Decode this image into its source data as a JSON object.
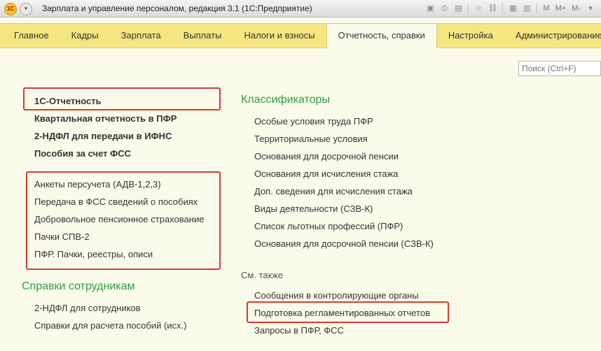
{
  "window": {
    "title": "Зарплата и управление персоналом, редакция 3.1  (1С:Предприятие)",
    "logo_text": "1С",
    "toolbar_labels": [
      "M",
      "M+",
      "M-"
    ]
  },
  "nav": {
    "tabs": [
      {
        "label": "Главное",
        "active": false
      },
      {
        "label": "Кадры",
        "active": false
      },
      {
        "label": "Зарплата",
        "active": false
      },
      {
        "label": "Выплаты",
        "active": false
      },
      {
        "label": "Налоги и взносы",
        "active": false
      },
      {
        "label": "Отчетность, справки",
        "active": true
      },
      {
        "label": "Настройка",
        "active": false
      },
      {
        "label": "Администрирование",
        "active": false
      }
    ]
  },
  "search": {
    "placeholder": "Поиск (Ctrl+F)"
  },
  "left": {
    "bold_links": [
      "1С-Отчетность",
      "Квартальная отчетность в ПФР",
      "2-НДФЛ для передачи в ИФНС",
      "Пособия за счет ФСС"
    ],
    "links": [
      "Анкеты персучета (АДВ-1,2,3)",
      "Передача в ФСС сведений о пособиях",
      "Добровольное пенсионное страхование",
      "Пачки СПВ-2",
      "ПФР. Пачки, реестры, описи"
    ],
    "spravki_heading": "Справки сотрудникам",
    "spravki_links": [
      "2-НДФЛ для сотрудников",
      "Справки для расчета пособий (исх.)"
    ]
  },
  "right": {
    "classifiers_heading": "Классификаторы",
    "classifiers": [
      "Особые условия труда ПФР",
      "Территориальные условия",
      "Основания для досрочной пенсии",
      "Основания для исчисления стажа",
      "Доп. сведения для исчисления стажа",
      "Виды деятельности (СЗВ-К)",
      "Список льготных профессий (ПФР)",
      "Основания для досрочной пенсии (СЗВ-К)"
    ],
    "see_also_label": "См. также",
    "see_also": [
      "Сообщения в контролирующие органы",
      "Подготовка регламентированных отчетов",
      "Запросы в ПФР, ФСС"
    ]
  },
  "colors": {
    "nav_bg": "#f5e681",
    "page_bg": "#fbfbec",
    "heading": "#2e9e3e",
    "highlight_box": "#d93a2e"
  }
}
